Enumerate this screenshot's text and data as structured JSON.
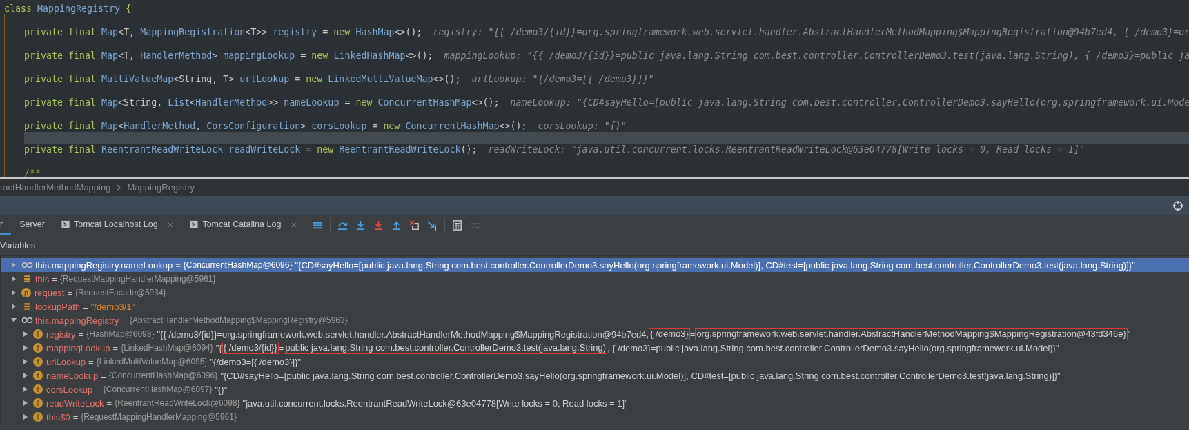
{
  "editor": {
    "lines": [
      {
        "tokens": [
          {
            "kind": "keyword",
            "text": "class "
          },
          {
            "kind": "name",
            "text": "MappingRegistry"
          },
          {
            "kind": "brace",
            "text": " {"
          }
        ],
        "current": false,
        "children": [
          {
            "current": false
          },
          {
            "tokens": [
              {
                "kind": "keyword",
                "text": "private final "
              },
              {
                "kind": "name",
                "text": "Map"
              },
              {
                "kind": "plain",
                "text": "<T, "
              },
              {
                "kind": "name",
                "text": "MappingRegistration"
              },
              {
                "kind": "plain",
                "text": "<T>> "
              },
              {
                "kind": "name",
                "text": "registry"
              },
              {
                "kind": "plain",
                "text": " = "
              },
              {
                "kind": "keyword",
                "text": "new "
              },
              {
                "kind": "name",
                "text": "HashMap"
              },
              {
                "kind": "plain",
                "text": "<>();"
              }
            ],
            "hint": "registry: \"{{ /demo3/{id}}=org.springframework.web.servlet.handler.AbstractHandlerMethodMapping$MappingRegistration@94b7ed4, { /demo3}=or",
            "current": false
          },
          {
            "current": false
          },
          {
            "tokens": [
              {
                "kind": "keyword",
                "text": "private final "
              },
              {
                "kind": "name",
                "text": "Map"
              },
              {
                "kind": "plain",
                "text": "<T, "
              },
              {
                "kind": "name",
                "text": "HandlerMethod"
              },
              {
                "kind": "plain",
                "text": "> "
              },
              {
                "kind": "name",
                "text": "mappingLookup"
              },
              {
                "kind": "plain",
                "text": " = "
              },
              {
                "kind": "keyword",
                "text": "new "
              },
              {
                "kind": "name",
                "text": "LinkedHashMap"
              },
              {
                "kind": "plain",
                "text": "<>();"
              }
            ],
            "hint": "mappingLookup: \"{{ /demo3/{id}}=public java.lang.String com.best.controller.ControllerDemo3.test(java.lang.String), { /demo3}=public ja",
            "current": false
          },
          {
            "current": false
          },
          {
            "tokens": [
              {
                "kind": "keyword",
                "text": "private final "
              },
              {
                "kind": "name",
                "text": "MultiValueMap"
              },
              {
                "kind": "plain",
                "text": "<String, T> "
              },
              {
                "kind": "name",
                "text": "urlLookup"
              },
              {
                "kind": "plain",
                "text": " = "
              },
              {
                "kind": "keyword",
                "text": "new "
              },
              {
                "kind": "name",
                "text": "LinkedMultiValueMap"
              },
              {
                "kind": "plain",
                "text": "<>();"
              }
            ],
            "hint": "urlLookup: \"{/demo3=[{ /demo3}]}\"",
            "current": false
          },
          {
            "current": false
          },
          {
            "tokens": [
              {
                "kind": "keyword",
                "text": "private final "
              },
              {
                "kind": "name",
                "text": "Map"
              },
              {
                "kind": "plain",
                "text": "<String, "
              },
              {
                "kind": "name",
                "text": "List"
              },
              {
                "kind": "plain",
                "text": "<"
              },
              {
                "kind": "name",
                "text": "HandlerMethod"
              },
              {
                "kind": "plain",
                "text": ">> "
              },
              {
                "kind": "name",
                "text": "nameLookup"
              },
              {
                "kind": "plain",
                "text": " = "
              },
              {
                "kind": "keyword",
                "text": "new "
              },
              {
                "kind": "name",
                "text": "ConcurrentHashMap"
              },
              {
                "kind": "plain",
                "text": "<>();"
              }
            ],
            "hint": "nameLookup: \"{CD#sayHello=[public java.lang.String com.best.controller.ControllerDemo3.sayHello(org.springframework.ui.Mode",
            "current": false
          },
          {
            "current": false
          },
          {
            "tokens": [
              {
                "kind": "keyword",
                "text": "private final "
              },
              {
                "kind": "name",
                "text": "Map"
              },
              {
                "kind": "plain",
                "text": "<"
              },
              {
                "kind": "name",
                "text": "HandlerMethod"
              },
              {
                "kind": "plain",
                "text": ", "
              },
              {
                "kind": "name",
                "text": "CorsConfiguration"
              },
              {
                "kind": "plain",
                "text": "> "
              },
              {
                "kind": "name",
                "text": "corsLookup"
              },
              {
                "kind": "plain",
                "text": " = "
              },
              {
                "kind": "keyword",
                "text": "new "
              },
              {
                "kind": "name",
                "text": "ConcurrentHashMap"
              },
              {
                "kind": "plain",
                "text": "<>();"
              }
            ],
            "hint": "corsLookup: \"{}\"",
            "current": false
          },
          {
            "current": true
          },
          {
            "tokens": [
              {
                "kind": "keyword",
                "text": "private final "
              },
              {
                "kind": "name",
                "text": "ReentrantReadWriteLock "
              },
              {
                "kind": "name",
                "text": "readWriteLock"
              },
              {
                "kind": "plain",
                "text": " = "
              },
              {
                "kind": "keyword",
                "text": "new "
              },
              {
                "kind": "name",
                "text": "ReentrantReadWriteLock"
              },
              {
                "kind": "plain",
                "text": "();"
              }
            ],
            "hint": "readWriteLock: \"java.util.concurrent.locks.ReentrantReadWriteLock@63e04778[Write locks = 0, Read locks = 1]\"",
            "current": false
          },
          {
            "current": false
          },
          {
            "tokens": [
              {
                "kind": "comment",
                "text": "/**"
              }
            ],
            "current": false
          }
        ]
      }
    ]
  },
  "breadcrumb": [
    "ractHandlerMethodMapping",
    "MappingRegistry"
  ],
  "debug_tabs": [
    {
      "label": "r",
      "selected": true,
      "kind": "plain"
    },
    {
      "label": "Server",
      "selected": false,
      "kind": "plain"
    },
    {
      "label": "Tomcat Localhost Log",
      "selected": false,
      "kind": "console",
      "close": "×"
    },
    {
      "label": "Tomcat Catalina Log",
      "selected": false,
      "kind": "console",
      "close": "×"
    }
  ],
  "toolbar": [
    {
      "kind": "frames",
      "disabled": false
    },
    {
      "kind": "step-over",
      "disabled": false
    },
    {
      "kind": "step-into",
      "disabled": false
    },
    {
      "kind": "force-step-into",
      "disabled": false
    },
    {
      "kind": "step-out",
      "disabled": false
    },
    {
      "kind": "drop-frame",
      "disabled": false
    },
    {
      "kind": "run-to-cursor",
      "disabled": false
    },
    {
      "kind": "evaluate",
      "disabled": false
    },
    {
      "kind": "trace",
      "disabled": true
    }
  ],
  "variables_title": "Variables",
  "variables": [
    {
      "kind": "watch",
      "name": "this.mappingRegistry.nameLookup",
      "eq": "=",
      "type": "{ConcurrentHashMap@6096}",
      "value": [
        {
          "text": "\"{CD#sayHello=[public java.lang.String com.best.controller.ControllerDemo3.sayHello(org.springframework.ui.Model)], CD#test=[public java.lang.String com.best.controller.ControllerDemo3.test(java.lang.String)]}\"",
          "boxed": false
        }
      ],
      "selected": true,
      "expanded": false
    },
    {
      "kind": "fields",
      "name": "this",
      "eq": "=",
      "type": "{RequestMappingHandlerMapping@5961}",
      "selected": false,
      "expanded": false
    },
    {
      "kind": "badge",
      "badge": "p",
      "name": "request",
      "eq": "=",
      "type": "{RequestFacade@5934}",
      "selected": false,
      "expanded": false
    },
    {
      "kind": "fields",
      "name": "lookupPath",
      "eq": "=",
      "string": "\"/demo3/1\"",
      "selected": false,
      "expanded": false
    },
    {
      "kind": "watch",
      "name": "this.mappingRegistry",
      "eq": "=",
      "type": "{AbstractHandlerMethodMapping$MappingRegistry@5963}",
      "selected": false,
      "expanded": true,
      "children": [
        {
          "kind": "badge",
          "badge": "f",
          "name": "registry",
          "eq": "=",
          "type": "{HashMap@6093}",
          "value": [
            {
              "text": "\"{{ /demo3/{id}}=org.springframework.web.servlet.handler.AbstractHandlerMethodMapping$MappingRegistration@94b7ed4,",
              "boxed": false
            },
            {
              "text": "{ /demo3}",
              "boxed": true
            },
            {
              "text": "=",
              "boxed": false
            },
            {
              "text": "org.springframework.web.servlet.handler.AbstractHandlerMethodMapping$MappingRegistration@43fd346e}",
              "boxed": true
            },
            {
              "text": "\"",
              "boxed": false
            }
          ],
          "selected": false,
          "expanded": false
        },
        {
          "kind": "badge",
          "badge": "f",
          "name": "mappingLookup",
          "eq": "=",
          "type": "{LinkedHashMap@6094}",
          "value": [
            {
              "text": "\"{",
              "boxed": false
            },
            {
              "text": "{ /demo3/{id}}",
              "boxed": true
            },
            {
              "text": "=",
              "boxed": false
            },
            {
              "text": "public java.lang.String com.best.controller.ControllerDemo3.test(java.lang.String)",
              "boxed": true
            },
            {
              "text": ", { /demo3}=public java.lang.String com.best.controller.ControllerDemo3.sayHello(org.springframework.ui.Model)}\"",
              "boxed": false
            }
          ],
          "selected": false,
          "expanded": false
        },
        {
          "kind": "badge",
          "badge": "f",
          "name": "urlLookup",
          "eq": "=",
          "type": "{LinkedMultiValueMap@6095}",
          "value": [
            {
              "text": "\"{/demo3=[{ /demo3}]}\"",
              "boxed": false
            }
          ],
          "selected": false,
          "expanded": false
        },
        {
          "kind": "badge",
          "badge": "f",
          "name": "nameLookup",
          "eq": "=",
          "type": "{ConcurrentHashMap@6096}",
          "value": [
            {
              "text": "\"{CD#sayHello=[public java.lang.String com.best.controller.ControllerDemo3.sayHello(org.springframework.ui.Model)], CD#test=[public java.lang.String com.best.controller.ControllerDemo3.test(java.lang.String)]}\"",
              "boxed": false
            }
          ],
          "selected": false,
          "expanded": false
        },
        {
          "kind": "badge",
          "badge": "f",
          "name": "corsLookup",
          "eq": "=",
          "type": "{ConcurrentHashMap@6097}",
          "value": [
            {
              "text": "\"{}\"",
              "boxed": false
            }
          ],
          "selected": false,
          "expanded": false
        },
        {
          "kind": "badge",
          "badge": "f",
          "name": "readWriteLock",
          "eq": "=",
          "type": "{ReentrantReadWriteLock@6098}",
          "value": [
            {
              "text": "\"java.util.concurrent.locks.ReentrantReadWriteLock@63e04778[Write locks = 0, Read locks = 1]\"",
              "boxed": false
            }
          ],
          "selected": false,
          "expanded": false
        },
        {
          "kind": "badge",
          "badge": "f",
          "name": "this$0",
          "eq": "=",
          "type": "{RequestMappingHandlerMapping@5961}",
          "selected": false,
          "expanded": false
        }
      ]
    }
  ]
}
